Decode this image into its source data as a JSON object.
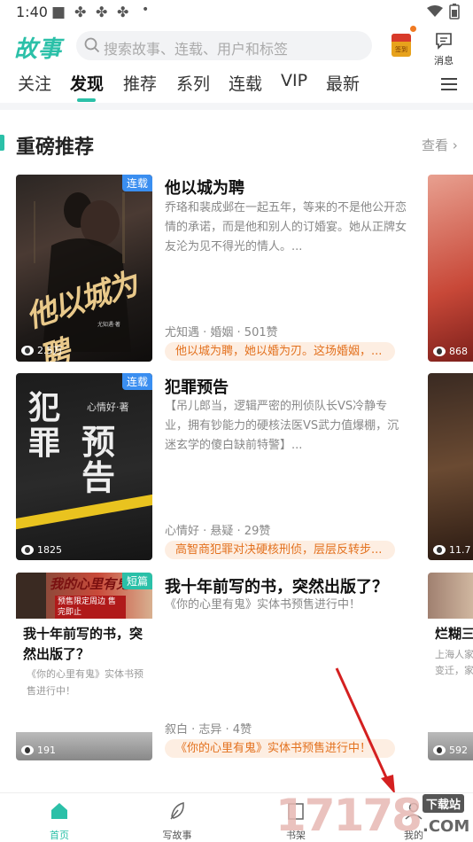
{
  "status_bar": {
    "time": "1:40"
  },
  "header": {
    "logo": "故事",
    "search_placeholder": "搜索故事、连载、用户和标签",
    "redpacket_label": "签到",
    "message_label": "消息"
  },
  "tabs": [
    {
      "label": "关注"
    },
    {
      "label": "发现",
      "active": true
    },
    {
      "label": "推荐"
    },
    {
      "label": "系列"
    },
    {
      "label": "连载"
    },
    {
      "label": "VIP"
    },
    {
      "label": "最新"
    }
  ],
  "section": {
    "title": "重磅推荐",
    "more": "查看"
  },
  "books": [
    {
      "badge": "连载",
      "cover_title": "他以城为聘",
      "cover_author": "尤知遇·著",
      "views": "2.5万",
      "title": "他以城为聘",
      "description": "乔珞和裴成邺在一起五年，等来的不是他公开恋情的承诺，而是他和别人的订婚宴。她从正牌女友沦为见不得光的情人。...",
      "meta": "尤知遇 · 婚姻 · 501赞",
      "highlight": "他以城为聘，她以婚为刃。这场婚姻，..."
    },
    {
      "badge": "连载",
      "cover_title": "犯罪预告",
      "cover_author": "心情好·著",
      "views": "1825",
      "title": "犯罪预告",
      "description": "【吊儿郎当，逻辑严密的刑侦队长VS冷静专业，拥有钞能力的硬核法医VS武力值爆棚，沉迷玄学的傻白缺前特警】...",
      "meta": "心情好 · 悬疑 · 29赞",
      "highlight": "高智商犯罪对决硬核刑侦，层层反转步..."
    },
    {
      "badge": "短篇",
      "cover_title": "我的心里有鬼",
      "cover_tag": "预售限定周边 售完即止",
      "views": "191",
      "title": "我十年前写的书，突然出版了？",
      "card_title": "我十年前写的书，突然出版了？",
      "description": "《你的心里有鬼》实体书预售进行中！",
      "card_description": "《你的心里有鬼》实体书预售进行中！",
      "meta": "叙白 · 志异 · 4赞",
      "highlight": "《你的心里有鬼》实体书预售进行中！"
    }
  ],
  "peek": [
    {
      "views": "868"
    },
    {
      "views": "11.7"
    },
    {
      "title": "烂糊三",
      "desc_line1": "上海人家",
      "desc_line2": "变迁，家",
      "views": "592"
    }
  ],
  "bottom_nav": [
    {
      "label": "首页",
      "active": true
    },
    {
      "label": "写故事"
    },
    {
      "label": "书架"
    },
    {
      "label": "我的"
    }
  ],
  "watermark": {
    "number": "17178",
    "tag": "下载站",
    "domain": ".COM"
  },
  "colors": {
    "accent": "#2bc0a8",
    "highlight_bg": "#fdeee2",
    "highlight_text": "#e3711e",
    "badge_blue": "#3a8ef0",
    "badge_green": "#2bc0a8",
    "arrow": "#d42020"
  }
}
